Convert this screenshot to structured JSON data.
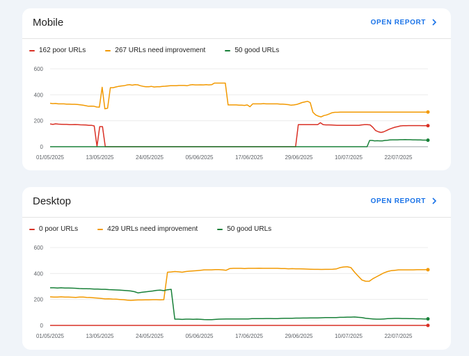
{
  "mobile": {
    "title": "Mobile",
    "open_report_label": "OPEN REPORT",
    "legend": [
      {
        "label": "162 poor URLs",
        "color": "#d93025"
      },
      {
        "label": "267 URLs need improvement",
        "color": "#f29900"
      },
      {
        "label": "50 good URLs",
        "color": "#188038"
      }
    ]
  },
  "desktop": {
    "title": "Desktop",
    "open_report_label": "OPEN REPORT",
    "legend": [
      {
        "label": "0 poor URLs",
        "color": "#d93025"
      },
      {
        "label": "429 URLs need improvement",
        "color": "#f29900"
      },
      {
        "label": "50 good URLs",
        "color": "#188038"
      }
    ]
  },
  "chart_data": [
    {
      "type": "line",
      "title": "Mobile",
      "ylim": [
        0,
        600
      ],
      "yticks": [
        0,
        200,
        400,
        600
      ],
      "x_tick_labels": [
        "01/05/2025",
        "13/05/2025",
        "24/05/2025",
        "05/06/2025",
        "17/06/2025",
        "29/06/2025",
        "10/07/2025",
        "22/07/2025"
      ],
      "series": [
        {
          "name": "162 poor URLs",
          "color": "#d93025",
          "values": [
            175,
            172,
            176,
            174,
            173,
            172,
            172,
            170,
            170,
            171,
            170,
            169,
            168,
            167,
            165,
            165,
            160,
            2,
            155,
            155,
            0,
            0,
            0,
            0,
            0,
            0,
            0,
            0,
            0,
            0,
            0,
            0,
            0,
            0,
            0,
            0,
            0,
            0,
            0,
            0,
            0,
            0,
            0,
            0,
            0,
            0,
            0,
            0,
            0,
            0,
            0,
            0,
            0,
            0,
            0,
            0,
            0,
            0,
            0,
            0,
            0,
            0,
            0,
            0,
            0,
            0,
            0,
            0,
            0,
            0,
            0,
            0,
            0,
            0,
            0,
            0,
            0,
            0,
            0,
            0,
            0,
            0,
            0,
            0,
            0,
            0,
            0,
            0,
            0,
            0,
            170,
            170,
            170,
            170,
            170,
            170,
            170,
            170,
            185,
            170,
            168,
            168,
            167,
            166,
            165,
            165,
            165,
            165,
            165,
            165,
            165,
            165,
            165,
            168,
            170,
            170,
            168,
            150,
            125,
            115,
            110,
            115,
            125,
            135,
            143,
            150,
            155,
            160,
            162,
            162,
            163,
            163,
            163,
            163,
            163,
            162,
            162,
            162
          ]
        },
        {
          "name": "267 URLs need improvement",
          "color": "#f29900",
          "values": [
            335,
            332,
            334,
            330,
            330,
            330,
            328,
            328,
            327,
            327,
            325,
            323,
            320,
            316,
            312,
            313,
            312,
            306,
            305,
            458,
            292,
            297,
            455,
            455,
            460,
            465,
            468,
            470,
            475,
            478,
            474,
            478,
            477,
            470,
            465,
            462,
            462,
            465,
            460,
            462,
            462,
            465,
            466,
            468,
            470,
            470,
            470,
            472,
            472,
            472,
            470,
            475,
            478,
            476,
            476,
            477,
            476,
            478,
            476,
            478,
            490,
            490,
            490,
            490,
            490,
            322,
            322,
            322,
            322,
            320,
            320,
            318,
            322,
            308,
            330,
            330,
            330,
            330,
            332,
            330,
            330,
            330,
            330,
            330,
            328,
            328,
            326,
            324,
            320,
            322,
            325,
            332,
            340,
            345,
            350,
            340,
            265,
            245,
            235,
            230,
            240,
            245,
            253,
            262,
            265,
            265,
            266,
            267,
            267,
            267,
            267,
            267,
            267,
            267,
            267,
            267,
            267,
            267,
            267,
            267,
            267,
            267,
            267,
            267,
            267,
            267,
            267,
            267,
            267,
            267,
            267,
            267,
            267,
            267,
            267,
            267,
            267,
            267,
            267
          ]
        },
        {
          "name": "50 good URLs",
          "color": "#188038",
          "values": [
            0,
            0,
            0,
            0,
            0,
            0,
            0,
            0,
            0,
            0,
            0,
            0,
            0,
            0,
            0,
            0,
            0,
            0,
            0,
            0,
            0,
            0,
            0,
            0,
            0,
            0,
            0,
            0,
            0,
            0,
            0,
            0,
            0,
            0,
            0,
            0,
            0,
            0,
            0,
            0,
            0,
            0,
            0,
            0,
            0,
            0,
            0,
            0,
            0,
            0,
            0,
            0,
            0,
            0,
            0,
            0,
            0,
            0,
            0,
            0,
            0,
            0,
            0,
            0,
            0,
            0,
            0,
            0,
            0,
            0,
            0,
            0,
            0,
            0,
            0,
            0,
            0,
            0,
            0,
            0,
            0,
            0,
            0,
            0,
            0,
            0,
            0,
            0,
            0,
            0,
            0,
            0,
            0,
            0,
            0,
            0,
            0,
            0,
            0,
            0,
            0,
            0,
            0,
            0,
            0,
            0,
            0,
            0,
            0,
            0,
            0,
            0,
            0,
            0,
            0,
            0,
            0,
            0,
            0,
            0,
            0,
            0,
            0,
            0,
            0,
            0,
            48,
            48,
            45,
            46,
            45,
            45,
            48,
            50,
            52,
            53,
            53,
            53,
            54,
            54,
            55,
            54,
            54,
            53,
            53,
            52,
            52,
            51,
            51,
            50
          ]
        }
      ]
    },
    {
      "type": "line",
      "title": "Desktop",
      "ylim": [
        0,
        600
      ],
      "yticks": [
        0,
        200,
        400,
        600
      ],
      "x_tick_labels": [
        "01/05/2025",
        "13/05/2025",
        "24/05/2025",
        "05/06/2025",
        "17/06/2025",
        "29/06/2025",
        "10/07/2025",
        "22/07/2025"
      ],
      "series": [
        {
          "name": "0 poor URLs",
          "color": "#d93025",
          "values": [
            0,
            0,
            0,
            0,
            0,
            0,
            0,
            0,
            0,
            0,
            0,
            0,
            0,
            0,
            0,
            0,
            0,
            0,
            0,
            0,
            0,
            0,
            0,
            0,
            0,
            0,
            0,
            0,
            0,
            0,
            0,
            0,
            0,
            0,
            0,
            0,
            0,
            0,
            0,
            0,
            0,
            0,
            0,
            0,
            0,
            0,
            0,
            0,
            0,
            0,
            0,
            0,
            0,
            0,
            0,
            0,
            0,
            0,
            0,
            0,
            0,
            0,
            0,
            0,
            0,
            0,
            0,
            0,
            0,
            0,
            0,
            0,
            0,
            0,
            0,
            0,
            0,
            0,
            0,
            0,
            0,
            0,
            0,
            0,
            0,
            0,
            0,
            0,
            0
          ]
        },
        {
          "name": "429 URLs need improvement",
          "color": "#f29900",
          "values": [
            220,
            218,
            218,
            220,
            218,
            218,
            217,
            216,
            218,
            218,
            216,
            215,
            212,
            210,
            208,
            204,
            205,
            203,
            202,
            200,
            198,
            195,
            193,
            195,
            196,
            196,
            197,
            197,
            198,
            198,
            197,
            198,
            410,
            412,
            415,
            413,
            410,
            415,
            418,
            420,
            422,
            425,
            428,
            428,
            428,
            430,
            430,
            428,
            425,
            438,
            440,
            440,
            440,
            438,
            440,
            440,
            440,
            441,
            440,
            440,
            440,
            440,
            440,
            438,
            438,
            436,
            437,
            436,
            436,
            435,
            434,
            433,
            432,
            432,
            431,
            432,
            432,
            433,
            435,
            445,
            450,
            452,
            445,
            410,
            380,
            350,
            340,
            340,
            360,
            375,
            390,
            405,
            415,
            422,
            425,
            428,
            428,
            428,
            428,
            428,
            429,
            429,
            429,
            429
          ]
        },
        {
          "name": "50 good URLs",
          "color": "#188038",
          "values": [
            290,
            290,
            288,
            290,
            288,
            288,
            287,
            286,
            284,
            283,
            283,
            282,
            280,
            280,
            278,
            278,
            276,
            275,
            273,
            272,
            270,
            268,
            265,
            260,
            250,
            255,
            258,
            262,
            265,
            270,
            272,
            268,
            275,
            278,
            48,
            48,
            46,
            48,
            48,
            47,
            48,
            47,
            45,
            44,
            44,
            46,
            48,
            49,
            50,
            50,
            50,
            50,
            50,
            50,
            50,
            52,
            52,
            52,
            52,
            53,
            53,
            52,
            52,
            54,
            55,
            55,
            55,
            56,
            56,
            57,
            57,
            58,
            58,
            58,
            59,
            60,
            60,
            60,
            60,
            62,
            62,
            64,
            64,
            65,
            62,
            60,
            55,
            52,
            50,
            48,
            48,
            50,
            52,
            53,
            54,
            54,
            53,
            53,
            52,
            52,
            51,
            51,
            50,
            50
          ]
        }
      ]
    }
  ]
}
